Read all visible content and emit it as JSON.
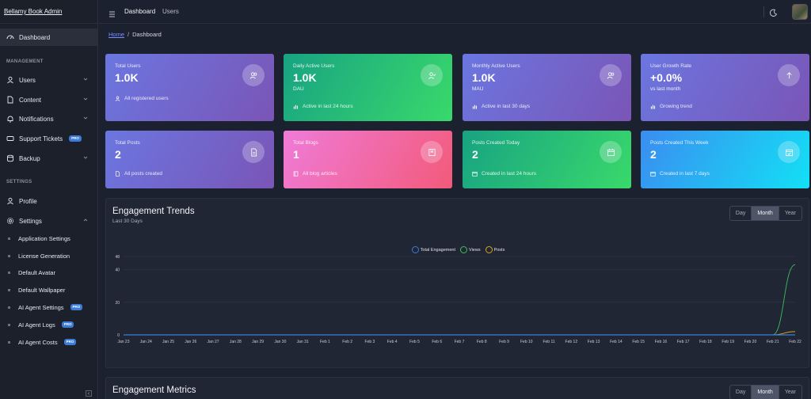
{
  "brand": "Bellamy Book Admin",
  "header": {
    "crumb_dashboard": "Dashboard",
    "crumb_users": "Users"
  },
  "breadcrumb": {
    "home": "Home",
    "sep": "/",
    "current": "Dashboard"
  },
  "sidebar": {
    "dashboard": "Dashboard",
    "management_label": "MANAGEMENT",
    "users": "Users",
    "content": "Content",
    "notifications": "Notifications",
    "support": "Support Tickets",
    "backup": "Backup",
    "settings_label": "SETTINGS",
    "profile": "Profile",
    "settings": "Settings",
    "pro": "PRO",
    "subitems": [
      "Application Settings",
      "License Generation",
      "Default Avatar",
      "Default Wallpaper",
      "AI Agent Settings",
      "AI Agent Logs",
      "AI Agent Costs"
    ]
  },
  "cards": [
    {
      "label": "Total Users",
      "value": "1.0K",
      "unit": "",
      "foot": "All registered users"
    },
    {
      "label": "Daily Active Users",
      "value": "1.0K",
      "unit": "DAU",
      "foot": "Active in last 24 hours"
    },
    {
      "label": "Monthly Active Users",
      "value": "1.0K",
      "unit": "MAU",
      "foot": "Active in last 30 days"
    },
    {
      "label": "User Growth Rate",
      "value": "+0.0%",
      "unit": "vs last month",
      "foot": "Growing trend"
    },
    {
      "label": "Total Posts",
      "value": "2",
      "unit": "",
      "foot": "All posts created"
    },
    {
      "label": "Total Blogs",
      "value": "1",
      "unit": "",
      "foot": "All blog articles"
    },
    {
      "label": "Posts Created Today",
      "value": "2",
      "unit": "",
      "foot": "Created in last 24 hours"
    },
    {
      "label": "Posts Created This Week",
      "value": "2",
      "unit": "",
      "foot": "Created in last 7 days"
    }
  ],
  "trends": {
    "title": "Engagement Trends",
    "subtitle": "Last 30 Days",
    "ranges": [
      "Day",
      "Month",
      "Year"
    ],
    "selected_range": "Month"
  },
  "metrics": {
    "title": "Engagement Metrics",
    "ranges": [
      "Day",
      "Month",
      "Year"
    ],
    "selected_range": "Month"
  },
  "colors": {
    "total_engagement": "#3b7bd9",
    "views": "#3bbf5a",
    "posts": "#d9a520"
  },
  "chart_data": {
    "type": "line",
    "title": "Engagement Trends",
    "ylim": [
      0,
      48
    ],
    "y_ticks": [
      "0",
      "20",
      "40",
      "48"
    ],
    "x": [
      "Jan 23",
      "Jan 24",
      "Jan 25",
      "Jan 26",
      "Jan 27",
      "Jan 28",
      "Jan 29",
      "Jan 30",
      "Jan 31",
      "Feb 1",
      "Feb 2",
      "Feb 3",
      "Feb 4",
      "Feb 5",
      "Feb 6",
      "Feb 7",
      "Feb 8",
      "Feb 9",
      "Feb 10",
      "Feb 11",
      "Feb 12",
      "Feb 13",
      "Feb 14",
      "Feb 15",
      "Feb 16",
      "Feb 17",
      "Feb 18",
      "Feb 19",
      "Feb 20",
      "Feb 21",
      "Feb 22"
    ],
    "series": [
      {
        "name": "Total Engagement",
        "values": [
          0,
          0,
          0,
          0,
          0,
          0,
          0,
          0,
          0,
          0,
          0,
          0,
          0,
          0,
          0,
          0,
          0,
          0,
          0,
          0,
          0,
          0,
          0,
          0,
          0,
          0,
          0,
          0,
          0,
          0,
          0
        ]
      },
      {
        "name": "Views",
        "values": [
          0,
          0,
          0,
          0,
          0,
          0,
          0,
          0,
          0,
          0,
          0,
          0,
          0,
          0,
          0,
          0,
          0,
          0,
          0,
          0,
          0,
          0,
          0,
          0,
          0,
          0,
          0,
          0,
          0,
          0,
          43
        ]
      },
      {
        "name": "Posts",
        "values": [
          0,
          0,
          0,
          0,
          0,
          0,
          0,
          0,
          0,
          0,
          0,
          0,
          0,
          0,
          0,
          0,
          0,
          0,
          0,
          0,
          0,
          0,
          0,
          0,
          0,
          0,
          0,
          0,
          0,
          0,
          2
        ]
      }
    ],
    "legend": "top-center",
    "grid": true
  }
}
